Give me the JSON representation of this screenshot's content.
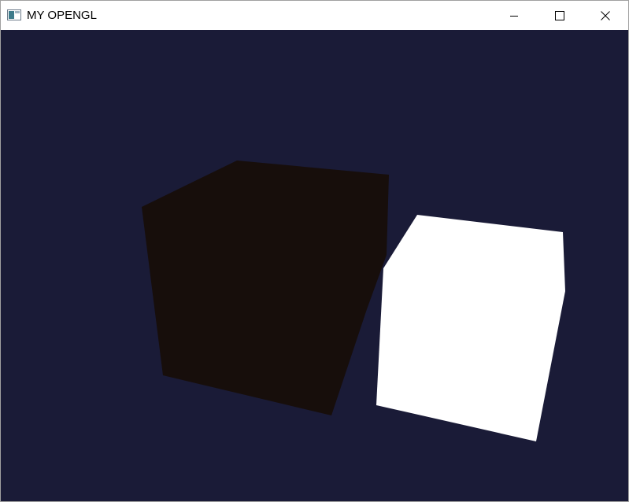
{
  "window": {
    "title": "MY OPENGL",
    "icon": "window-app-icon",
    "controls": {
      "minimize_icon": "minimize-icon",
      "maximize_icon": "maximize-icon",
      "close_icon": "close-icon"
    }
  },
  "scene": {
    "background_color": "#1a1b37",
    "objects": [
      {
        "name": "dark-cube",
        "color": "#170e0b"
      },
      {
        "name": "light-cube",
        "color": "#ffffff"
      }
    ]
  }
}
